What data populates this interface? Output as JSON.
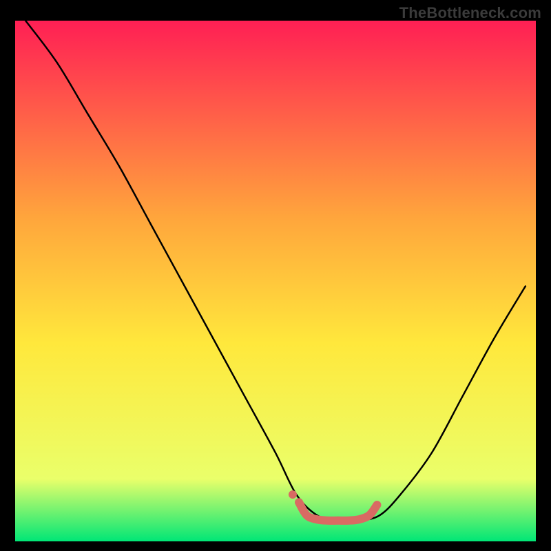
{
  "watermark": "TheBottleneck.com",
  "chart_data": {
    "type": "line",
    "title": "",
    "xlabel": "",
    "ylabel": "",
    "xlim": [
      0,
      100
    ],
    "ylim": [
      0,
      100
    ],
    "series": [
      {
        "name": "curve",
        "color": "#000000",
        "x": [
          2,
          8,
          14,
          20,
          26,
          32,
          38,
          44,
          50,
          54,
          58,
          62,
          66,
          70,
          74,
          80,
          86,
          92,
          98
        ],
        "y": [
          100,
          92,
          82,
          72,
          61,
          50,
          39,
          28,
          17,
          9,
          5,
          4,
          4,
          5,
          9,
          17,
          28,
          39,
          49
        ]
      },
      {
        "name": "highlight",
        "color": "#d96a63",
        "x": [
          54.5,
          56,
          58,
          60,
          62,
          64,
          66,
          68,
          69.5
        ],
        "y": [
          7.5,
          5,
          4.2,
          4,
          4,
          4,
          4.2,
          5,
          7
        ]
      }
    ],
    "background_gradient": {
      "top": "#ff1f54",
      "mid_up": "#ffa63c",
      "mid": "#ffe83c",
      "low": "#eaff6a",
      "bottom": "#00e676"
    }
  }
}
